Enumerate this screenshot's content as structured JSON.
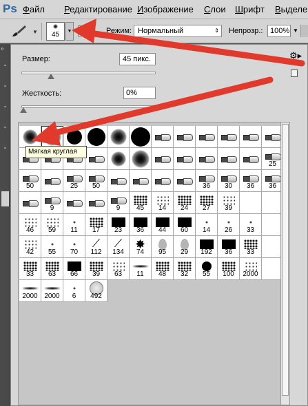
{
  "app": {
    "logo": "Ps"
  },
  "menu": [
    {
      "label": "Файл",
      "underline": "Ф",
      "rest": "айл"
    },
    {
      "label": "Редактирование",
      "underline": "Р",
      "rest": "едактирование"
    },
    {
      "label": "Изображение",
      "underline": "И",
      "rest": "зображение"
    },
    {
      "label": "Слои",
      "underline": "С",
      "rest": "лои"
    },
    {
      "label": "Шрифт",
      "underline": "Ш",
      "rest": "рифт"
    },
    {
      "label": "Выделен",
      "underline": "В",
      "rest": "ыделен"
    }
  ],
  "options_bar": {
    "brush_size": "45",
    "mode_label": "Режим:",
    "mode_value": "Нормальный",
    "opacity_label": "Непрозр.:",
    "opacity_value": "100%"
  },
  "picker": {
    "size_label": "Размер:",
    "size_value": "45 пикс.",
    "size_slider_fraction": 0.22,
    "hardness_label": "Жесткость:",
    "hardness_value": "0%",
    "hardness_slider_fraction": 0.0
  },
  "tooltip": "Мягкая круглая",
  "brushes": [
    {
      "k": "soft",
      "s": 22,
      "n": ""
    },
    {
      "k": "soft",
      "s": 26,
      "n": ""
    },
    {
      "k": "hard",
      "s": 22,
      "n": ""
    },
    {
      "k": "hard",
      "s": 26,
      "n": ""
    },
    {
      "k": "soft",
      "s": 24,
      "n": ""
    },
    {
      "k": "hard",
      "s": 28,
      "n": ""
    },
    {
      "k": "pen",
      "n": ""
    },
    {
      "k": "pen",
      "n": ""
    },
    {
      "k": "pen",
      "n": ""
    },
    {
      "k": "pen",
      "n": ""
    },
    {
      "k": "pen",
      "n": ""
    },
    {
      "k": "pen",
      "n": ""
    },
    {
      "k": "pen",
      "n": ""
    },
    {
      "k": "pen",
      "n": ""
    },
    {
      "k": "pen",
      "n": ""
    },
    {
      "k": "pen",
      "n": ""
    },
    {
      "k": "soft",
      "s": 22,
      "n": ""
    },
    {
      "k": "soft",
      "s": 26,
      "n": ""
    },
    {
      "k": "pen",
      "n": ""
    },
    {
      "k": "pen",
      "n": ""
    },
    {
      "k": "pen",
      "n": ""
    },
    {
      "k": "pen",
      "n": ""
    },
    {
      "k": "pen",
      "n": ""
    },
    {
      "k": "pen",
      "n": "25"
    },
    {
      "k": "pen",
      "n": "50"
    },
    {
      "k": "pen",
      "n": ""
    },
    {
      "k": "pen",
      "n": "25"
    },
    {
      "k": "pen",
      "n": "50"
    },
    {
      "k": "pen",
      "n": ""
    },
    {
      "k": "pen",
      "n": ""
    },
    {
      "k": "pen",
      "n": ""
    },
    {
      "k": "pen",
      "n": ""
    },
    {
      "k": "pen",
      "n": "36"
    },
    {
      "k": "pen",
      "n": "30"
    },
    {
      "k": "pen",
      "n": "36"
    },
    {
      "k": "pen",
      "n": "36"
    },
    {
      "k": "pen",
      "n": ""
    },
    {
      "k": "pen",
      "n": "9"
    },
    {
      "k": "pen",
      "n": ""
    },
    {
      "k": "pen",
      "n": ""
    },
    {
      "k": "pen",
      "n": "9"
    },
    {
      "k": "splat",
      "n": "45"
    },
    {
      "k": "sparse",
      "n": "14"
    },
    {
      "k": "splat",
      "n": "24"
    },
    {
      "k": "splat",
      "n": "27"
    },
    {
      "k": "sparse",
      "n": "39"
    },
    {
      "k": "blank",
      "n": ""
    },
    {
      "k": "blank",
      "n": ""
    },
    {
      "k": "sparse",
      "n": "46"
    },
    {
      "k": "sparse",
      "n": "59"
    },
    {
      "k": "dot",
      "n": "11"
    },
    {
      "k": "splat",
      "n": "17"
    },
    {
      "k": "dense",
      "n": "23"
    },
    {
      "k": "dense",
      "n": "36"
    },
    {
      "k": "dense",
      "n": "44"
    },
    {
      "k": "dense",
      "n": "60"
    },
    {
      "k": "dot",
      "n": "14"
    },
    {
      "k": "dot",
      "n": "26"
    },
    {
      "k": "dot",
      "n": "33"
    },
    {
      "k": "blank",
      "n": ""
    },
    {
      "k": "sparse",
      "n": "42"
    },
    {
      "k": "dot",
      "n": "55"
    },
    {
      "k": "dot",
      "n": "70"
    },
    {
      "k": "grass",
      "n": "112"
    },
    {
      "k": "grass",
      "n": "134"
    },
    {
      "k": "star",
      "n": "74"
    },
    {
      "k": "leaf",
      "n": "95"
    },
    {
      "k": "leaf",
      "n": "29"
    },
    {
      "k": "dense",
      "n": "192"
    },
    {
      "k": "dense",
      "n": "36"
    },
    {
      "k": "splat",
      "n": "33"
    },
    {
      "k": "blank",
      "n": ""
    },
    {
      "k": "splat",
      "n": "33"
    },
    {
      "k": "splat",
      "n": "63"
    },
    {
      "k": "dense",
      "n": "66"
    },
    {
      "k": "splat",
      "n": "39"
    },
    {
      "k": "sparse",
      "n": "63"
    },
    {
      "k": "line",
      "n": "11"
    },
    {
      "k": "splat",
      "n": "48"
    },
    {
      "k": "splat",
      "n": "32"
    },
    {
      "k": "hard",
      "s": 14,
      "n": "55"
    },
    {
      "k": "splat",
      "n": "100"
    },
    {
      "k": "sparse",
      "n": "2000"
    },
    {
      "k": "blank",
      "n": ""
    },
    {
      "k": "line",
      "n": "2000"
    },
    {
      "k": "line",
      "n": "2000"
    },
    {
      "k": "dot",
      "n": "6"
    },
    {
      "k": "circle",
      "n": "492"
    }
  ]
}
